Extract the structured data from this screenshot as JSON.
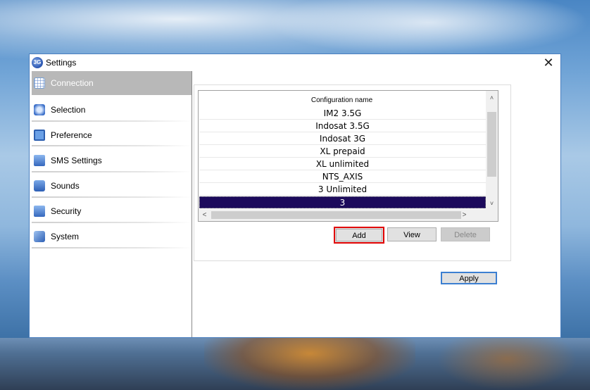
{
  "window": {
    "title": "Settings",
    "app_icon_text": "3G",
    "close_glyph": "✕"
  },
  "sidebar": {
    "items": [
      {
        "label": "Connection",
        "icon": "network-globe-icon",
        "active": true
      },
      {
        "label": "Selection",
        "icon": "selection-icon",
        "active": false
      },
      {
        "label": "Preference",
        "icon": "preference-icon",
        "active": false
      },
      {
        "label": "SMS Settings",
        "icon": "sms-envelope-icon",
        "active": false
      },
      {
        "label": "Sounds",
        "icon": "speaker-icon",
        "active": false
      },
      {
        "label": "Security",
        "icon": "lock-icon",
        "active": false
      },
      {
        "label": "System",
        "icon": "wrench-icon",
        "active": false
      }
    ]
  },
  "config_list": {
    "header": "Configuration name",
    "rows": [
      "IM2 3.5G",
      "Indosat 3.5G",
      "Indosat 3G",
      "XL prepaid",
      "XL unlimited",
      "NTS_AXIS",
      "3 Unlimited",
      "3"
    ],
    "selected_index": 7,
    "scroll_up_glyph": "˄",
    "scroll_down_glyph": "˅",
    "scroll_left_glyph": "<",
    "scroll_right_glyph": ">"
  },
  "buttons": {
    "add": "Add",
    "view": "View",
    "delete": "Delete",
    "apply": "Apply"
  },
  "colors": {
    "selected_row": "#1c0a5c",
    "active_nav": "#b8b8b8",
    "add_highlight": "#e00000",
    "apply_border": "#3c7fd1"
  }
}
